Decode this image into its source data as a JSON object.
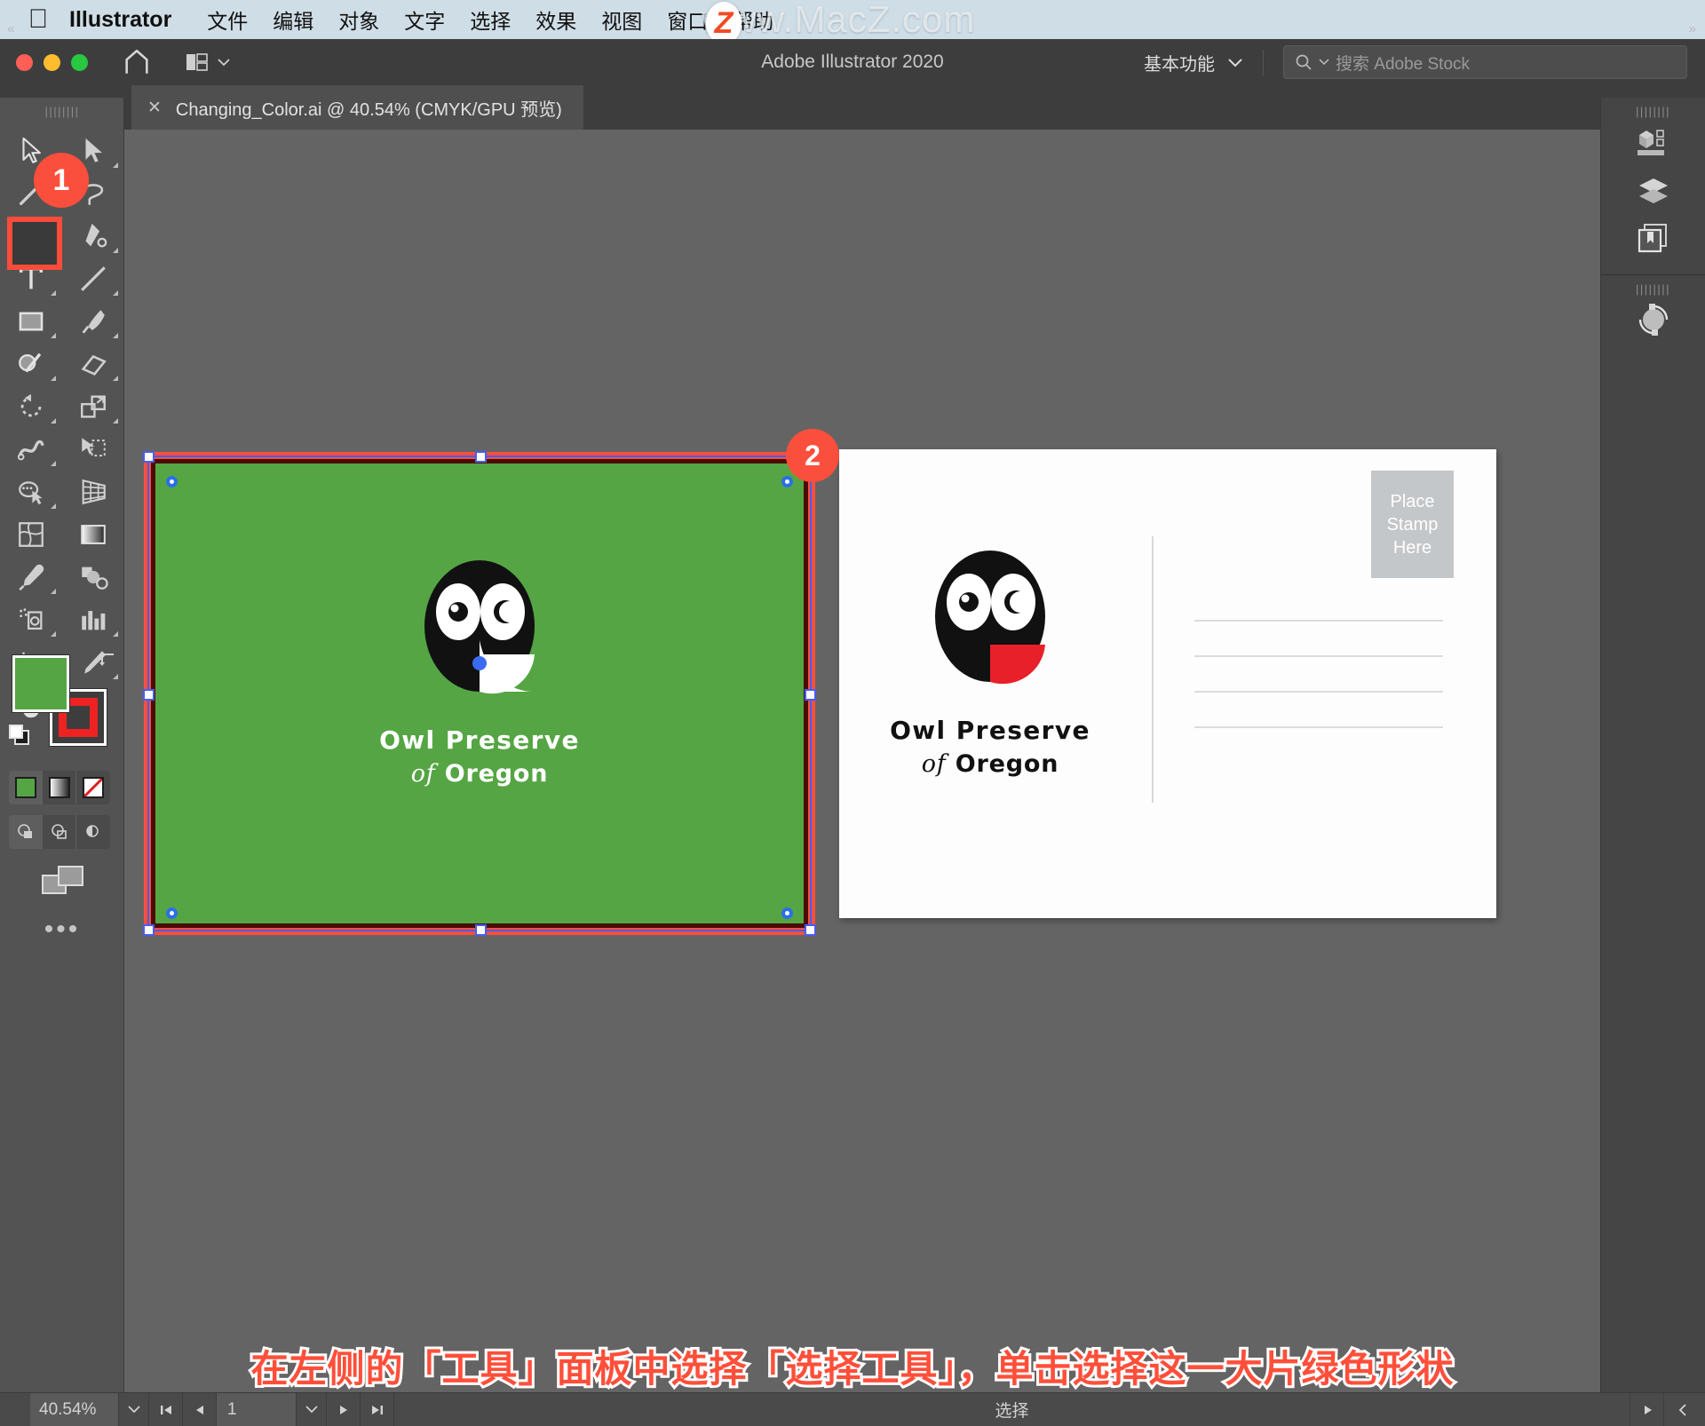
{
  "mac_menu": {
    "apple_icon": "apple-logo",
    "app_name": "Illustrator",
    "items": [
      "文件",
      "编辑",
      "对象",
      "文字",
      "选择",
      "效果",
      "视图",
      "窗口",
      "帮助"
    ],
    "watermark": "www.MacZ.com"
  },
  "titlebar": {
    "title": "Adobe Illustrator 2020",
    "home_icon": "home-icon",
    "arrange_icon": "arrange-documents-icon",
    "arrange_caret": "chevron-down-icon",
    "workspace": "基本功能",
    "workspace_caret": "chevron-down-icon",
    "search_icon": "search-icon",
    "search_caret": "chevron-down-icon",
    "search_placeholder": "搜索 Adobe Stock"
  },
  "tab": {
    "close_icon": "close-icon",
    "label": "Changing_Color.ai @ 40.54% (CMYK/GPU 预览)"
  },
  "toolbar": {
    "collapse_icon": "collapse-panel-icon",
    "grip": "panel-grip",
    "tools": [
      [
        "selection-tool",
        "direct-selection-tool"
      ],
      [
        "magic-wand-tool",
        "lasso-tool"
      ],
      [
        "pen-tool",
        "curvature-tool"
      ],
      [
        "type-tool",
        "line-segment-tool"
      ],
      [
        "rectangle-tool",
        "paintbrush-tool"
      ],
      [
        "shaper-tool",
        "eraser-tool"
      ],
      [
        "rotate-tool",
        "scale-tool"
      ],
      [
        "width-tool",
        "free-transform-tool"
      ],
      [
        "shape-builder-tool",
        "perspective-grid-tool"
      ],
      [
        "mesh-tool",
        "gradient-tool"
      ],
      [
        "eyedropper-tool",
        "blend-tool"
      ],
      [
        "symbol-sprayer-tool",
        "column-graph-tool"
      ],
      [
        "artboard-tool",
        "slice-tool"
      ],
      [
        "hand-tool",
        "zoom-tool"
      ]
    ],
    "fill_color": "#55a544",
    "stroke_color": "#ee2222",
    "swap_icon": "swap-fill-stroke-icon",
    "default_icon": "default-fill-stroke-icon",
    "color_modes": [
      "solid-color-mode",
      "gradient-mode",
      "none-mode"
    ],
    "draw_modes": [
      "draw-normal-mode",
      "draw-behind-mode",
      "draw-inside-mode"
    ],
    "screen_mode_icon": "change-screen-mode-icon",
    "more_tools": "•••"
  },
  "badges": {
    "step1": "1",
    "step2": "2",
    "color": "#fa4f3c"
  },
  "canvas": {
    "artboard_green": {
      "name": "postcard-front",
      "fill": "#55a544",
      "selection_stroke": "#fa4f3c",
      "bbox_color": "#4a5cf0",
      "logo_title": "Owl Preserve",
      "logo_of": "of",
      "logo_place": "Oregon",
      "logo_text_color": "#ffffff",
      "owl_body": "#111111",
      "owl_chest": "#ffffff",
      "anchor_point_color": "#3a6bf0"
    },
    "artboard_white": {
      "name": "postcard-back",
      "fill": "#fdfdfd",
      "logo_title": "Owl Preserve",
      "logo_of": "of",
      "logo_place": "Oregon",
      "logo_text_color": "#111111",
      "owl_body": "#111111",
      "owl_chest": "#e8202a",
      "stamp_lines": [
        "Place",
        "Stamp",
        "Here"
      ],
      "stamp_bg": "#c4c7c9",
      "address_line_count": 4
    }
  },
  "rightdock": {
    "collapse_icon": "expand-panel-icon",
    "items": [
      "properties-panel-icon",
      "layers-panel-icon",
      "libraries-panel-icon"
    ],
    "secondary": [
      "transform-rotate-icon"
    ]
  },
  "caption": {
    "text": "在左侧的「工具」面板中选择「选择工具」，单击选择这一大片绿色形状",
    "color": "#ff4f3a",
    "outline": "#ffffff"
  },
  "statusbar": {
    "zoom": "40.54%",
    "zoom_caret": "chevron-down-icon",
    "first_icon": "first-artboard-icon",
    "prev_icon": "previous-artboard-icon",
    "page": "1",
    "page_caret": "chevron-down-icon",
    "next_icon": "next-artboard-icon",
    "last_icon": "last-artboard-icon",
    "status": "选择",
    "status_caret": "status-menu-icon",
    "resize_icon": "resize-grip-icon"
  }
}
